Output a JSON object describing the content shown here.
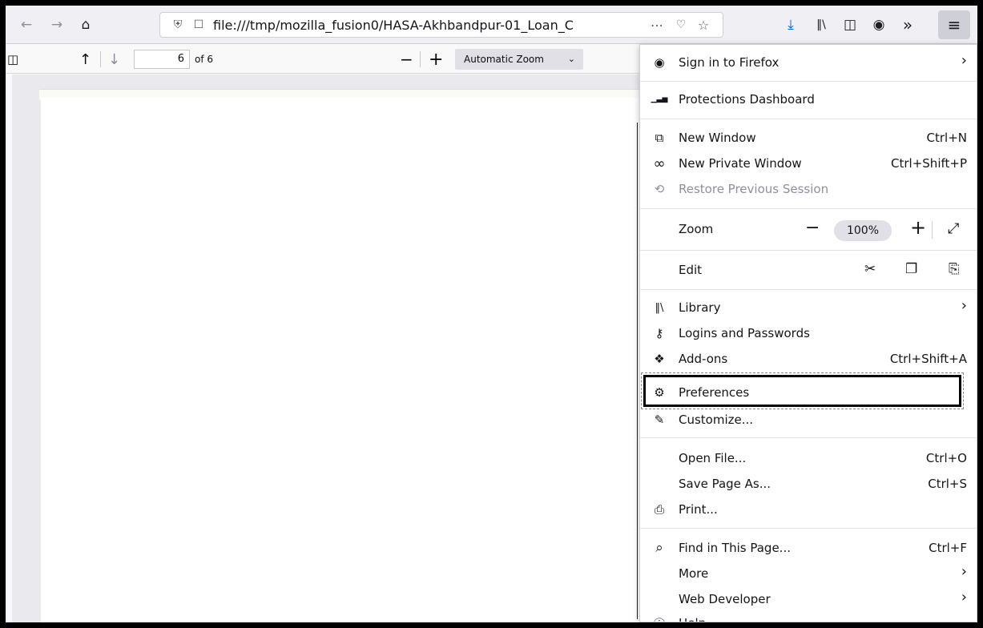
{
  "toolbar": {
    "url": "file:///tmp/mozilla_fusion0/HASA-Akhbandpur-01_Loan_C",
    "icons": {
      "back": "←",
      "forward": "→",
      "home": "⌂",
      "shield": "⛨",
      "page": "☐",
      "page_actions": "⋯",
      "pocket": "♡",
      "bookmark": "☆",
      "download": "⤓",
      "library": "‖\\",
      "sidebar": "◫",
      "account": "◉",
      "overflow": "»",
      "menu": "≡"
    }
  },
  "pdf": {
    "page_number": "6",
    "page_of": "of 6",
    "zoom_label": "Automatic Zoom",
    "icons": {
      "sidebar": "◫",
      "prev": "↑",
      "next": "↓",
      "zoom_out": "−",
      "zoom_in": "+",
      "chevron": "⌄"
    }
  },
  "menu": {
    "sign_in": {
      "label": "Sign in to Firefox",
      "icon": "◉",
      "arrow": "›"
    },
    "protections": {
      "label": "Protections Dashboard",
      "icon": "▁▃▅"
    },
    "new_window": {
      "label": "New Window",
      "shortcut": "Ctrl+N",
      "icon": "⧉"
    },
    "private_window": {
      "label": "New Private Window",
      "shortcut": "Ctrl+Shift+P",
      "icon": "∞"
    },
    "restore": {
      "label": "Restore Previous Session",
      "icon": "⟲"
    },
    "zoom": {
      "label": "Zoom",
      "minus": "−",
      "value": "100%",
      "plus": "+",
      "fullscreen": "⤢"
    },
    "edit": {
      "label": "Edit",
      "cut": "✂",
      "copy": "❐",
      "paste": "⎘"
    },
    "library": {
      "label": "Library",
      "icon": "‖\\",
      "arrow": "›"
    },
    "logins": {
      "label": "Logins and Passwords",
      "icon": "⚷"
    },
    "addons": {
      "label": "Add-ons",
      "shortcut": "Ctrl+Shift+A",
      "icon": "❖"
    },
    "preferences": {
      "label": "Preferences",
      "icon": "⚙"
    },
    "customize": {
      "label": "Customize...",
      "icon": "✎"
    },
    "open_file": {
      "label": "Open File...",
      "shortcut": "Ctrl+O"
    },
    "save_page": {
      "label": "Save Page As...",
      "shortcut": "Ctrl+S"
    },
    "print": {
      "label": "Print...",
      "icon": "⎙"
    },
    "find": {
      "label": "Find in This Page...",
      "shortcut": "Ctrl+F",
      "icon": "⌕"
    },
    "more": {
      "label": "More",
      "arrow": "›"
    },
    "web_developer": {
      "label": "Web Developer",
      "arrow": "›"
    },
    "help": {
      "label": "Help",
      "icon": "ⓘ"
    }
  }
}
